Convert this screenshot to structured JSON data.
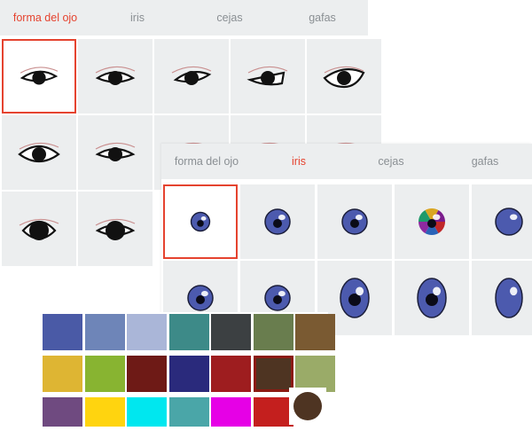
{
  "accent_color": "#e5432f",
  "panel_back": {
    "tabs": [
      {
        "label": "forma del ojo",
        "active": true
      },
      {
        "label": "iris",
        "active": false
      },
      {
        "label": "cejas",
        "active": false
      },
      {
        "label": "gafas",
        "active": false
      }
    ],
    "eye_shapes": [
      "eye-shape-1",
      "eye-shape-2",
      "eye-shape-3",
      "eye-shape-4",
      "eye-shape-5",
      "eye-shape-6",
      "eye-shape-7",
      "eye-shape-8",
      "eye-shape-9",
      "eye-shape-10",
      "eye-shape-11",
      "eye-shape-12"
    ],
    "selected_index": 0
  },
  "panel_front": {
    "tabs": [
      {
        "label": "forma del ojo",
        "active": false
      },
      {
        "label": "iris",
        "active": true
      },
      {
        "label": "cejas",
        "active": false
      },
      {
        "label": "gafas",
        "active": false
      }
    ],
    "iris_options": [
      "iris-1",
      "iris-2",
      "iris-3",
      "iris-rainbow",
      "iris-4",
      "iris-5",
      "iris-6",
      "iris-7",
      "iris-8",
      "iris-9"
    ],
    "selected_index": 0
  },
  "color_palette": {
    "colors": [
      "#4a5aa6",
      "#6e85b8",
      "#aab6d8",
      "#3d8a88",
      "#3c4042",
      "#697d4e",
      "#7a5a32",
      "#deb533",
      "#88b431",
      "#6e1a16",
      "#2a2a7c",
      "#9e1d1f",
      "#4e3422",
      "#9aab68",
      "#6f4a80",
      "#ffd40f",
      "#00e7ef",
      "#4aa6a8",
      "#e600e6",
      "#c41f1e"
    ],
    "selected_color": "#4e3422",
    "preview_color": "#4e3422"
  }
}
